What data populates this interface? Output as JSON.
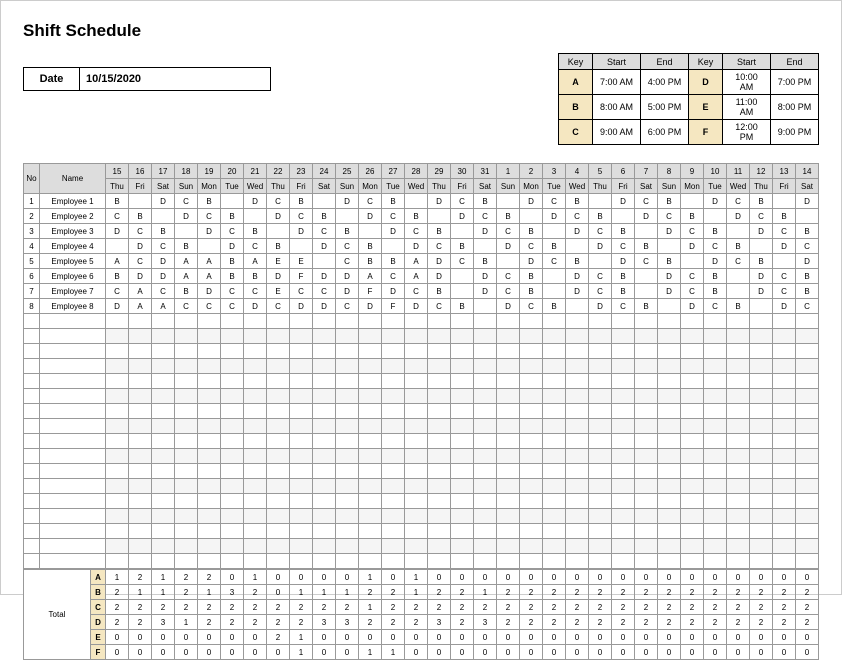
{
  "title": "Shift Schedule",
  "date": {
    "label": "Date",
    "value": "10/15/2020"
  },
  "key_table": {
    "headers": [
      "Key",
      "Start",
      "End",
      "Key",
      "Start",
      "End"
    ],
    "rows": [
      [
        "A",
        "7:00 AM",
        "4:00 PM",
        "D",
        "10:00 AM",
        "7:00 PM"
      ],
      [
        "B",
        "8:00 AM",
        "5:00 PM",
        "E",
        "11:00 AM",
        "8:00 PM"
      ],
      [
        "C",
        "9:00 AM",
        "6:00 PM",
        "F",
        "12:00 PM",
        "9:00 PM"
      ]
    ]
  },
  "schedule": {
    "no_header": "No",
    "name_header": "Name",
    "day_numbers": [
      "15",
      "16",
      "17",
      "18",
      "19",
      "20",
      "21",
      "22",
      "23",
      "24",
      "25",
      "26",
      "27",
      "28",
      "29",
      "30",
      "31",
      "1",
      "2",
      "3",
      "4",
      "5",
      "6",
      "7",
      "8",
      "9",
      "10",
      "11",
      "12",
      "13",
      "14"
    ],
    "day_names": [
      "Thu",
      "Fri",
      "Sat",
      "Sun",
      "Mon",
      "Tue",
      "Wed",
      "Thu",
      "Fri",
      "Sat",
      "Sun",
      "Mon",
      "Tue",
      "Wed",
      "Thu",
      "Fri",
      "Sat",
      "Sun",
      "Mon",
      "Tue",
      "Wed",
      "Thu",
      "Fri",
      "Sat",
      "Sun",
      "Mon",
      "Tue",
      "Wed",
      "Thu",
      "Fri",
      "Sat"
    ],
    "employees": [
      {
        "no": "1",
        "name": "Employee 1",
        "shifts": [
          "B",
          "",
          "D",
          "C",
          "B",
          "",
          "D",
          "C",
          "B",
          "",
          "D",
          "C",
          "B",
          "",
          "D",
          "C",
          "B",
          "",
          "D",
          "C",
          "B",
          "",
          "D",
          "C",
          "B",
          "",
          "D",
          "C",
          "B",
          "",
          "D"
        ]
      },
      {
        "no": "2",
        "name": "Employee 2",
        "shifts": [
          "C",
          "B",
          "",
          "D",
          "C",
          "B",
          "",
          "D",
          "C",
          "B",
          "",
          "D",
          "C",
          "B",
          "",
          "D",
          "C",
          "B",
          "",
          "D",
          "C",
          "B",
          "",
          "D",
          "C",
          "B",
          "",
          "D",
          "C",
          "B",
          ""
        ]
      },
      {
        "no": "3",
        "name": "Employee 3",
        "shifts": [
          "D",
          "C",
          "B",
          "",
          "D",
          "C",
          "B",
          "",
          "D",
          "C",
          "B",
          "",
          "D",
          "C",
          "B",
          "",
          "D",
          "C",
          "B",
          "",
          "D",
          "C",
          "B",
          "",
          "D",
          "C",
          "B",
          "",
          "D",
          "C",
          "B"
        ]
      },
      {
        "no": "4",
        "name": "Employee 4",
        "shifts": [
          "",
          "D",
          "C",
          "B",
          "",
          "D",
          "C",
          "B",
          "",
          "D",
          "C",
          "B",
          "",
          "D",
          "C",
          "B",
          "",
          "D",
          "C",
          "B",
          "",
          "D",
          "C",
          "B",
          "",
          "D",
          "C",
          "B",
          "",
          "D",
          "C"
        ]
      },
      {
        "no": "5",
        "name": "Employee 5",
        "shifts": [
          "A",
          "C",
          "D",
          "A",
          "A",
          "B",
          "A",
          "E",
          "E",
          "",
          "C",
          "B",
          "B",
          "A",
          "D",
          "C",
          "B",
          "",
          "D",
          "C",
          "B",
          "",
          "D",
          "C",
          "B",
          "",
          "D",
          "C",
          "B",
          "",
          "D"
        ]
      },
      {
        "no": "6",
        "name": "Employee 6",
        "shifts": [
          "B",
          "D",
          "D",
          "A",
          "A",
          "B",
          "B",
          "D",
          "F",
          "D",
          "D",
          "A",
          "C",
          "A",
          "D",
          "",
          "D",
          "C",
          "B",
          "",
          "D",
          "C",
          "B",
          "",
          "D",
          "C",
          "B",
          "",
          "D",
          "C",
          "B"
        ]
      },
      {
        "no": "7",
        "name": "Employee 7",
        "shifts": [
          "C",
          "A",
          "C",
          "B",
          "D",
          "C",
          "C",
          "E",
          "C",
          "C",
          "D",
          "F",
          "D",
          "C",
          "B",
          "",
          "D",
          "C",
          "B",
          "",
          "D",
          "C",
          "B",
          "",
          "D",
          "C",
          "B",
          "",
          "D",
          "C",
          "B"
        ]
      },
      {
        "no": "8",
        "name": "Employee 8",
        "shifts": [
          "D",
          "A",
          "A",
          "C",
          "C",
          "C",
          "D",
          "C",
          "D",
          "D",
          "C",
          "D",
          "F",
          "D",
          "C",
          "B",
          "",
          "D",
          "C",
          "B",
          "",
          "D",
          "C",
          "B",
          "",
          "D",
          "C",
          "B",
          "",
          "D",
          "C"
        ]
      }
    ],
    "empty_rows": 17
  },
  "totals": {
    "label": "Total",
    "keys": [
      "A",
      "B",
      "C",
      "D",
      "E",
      "F"
    ],
    "rows": {
      "A": [
        "1",
        "2",
        "1",
        "2",
        "2",
        "0",
        "1",
        "0",
        "0",
        "0",
        "0",
        "1",
        "0",
        "1",
        "0",
        "0",
        "0",
        "0",
        "0",
        "0",
        "0",
        "0",
        "0",
        "0",
        "0",
        "0",
        "0",
        "0",
        "0",
        "0",
        "0"
      ],
      "B": [
        "2",
        "1",
        "1",
        "2",
        "1",
        "3",
        "2",
        "0",
        "1",
        "1",
        "1",
        "2",
        "2",
        "1",
        "2",
        "2",
        "1",
        "2",
        "2",
        "2",
        "2",
        "2",
        "2",
        "2",
        "2",
        "2",
        "2",
        "2",
        "2",
        "2",
        "2"
      ],
      "C": [
        "2",
        "2",
        "2",
        "2",
        "2",
        "2",
        "2",
        "2",
        "2",
        "2",
        "2",
        "1",
        "2",
        "2",
        "2",
        "2",
        "2",
        "2",
        "2",
        "2",
        "2",
        "2",
        "2",
        "2",
        "2",
        "2",
        "2",
        "2",
        "2",
        "2",
        "2"
      ],
      "D": [
        "2",
        "2",
        "3",
        "1",
        "2",
        "2",
        "2",
        "2",
        "2",
        "3",
        "3",
        "2",
        "2",
        "2",
        "3",
        "2",
        "3",
        "2",
        "2",
        "2",
        "2",
        "2",
        "2",
        "2",
        "2",
        "2",
        "2",
        "2",
        "2",
        "2",
        "2"
      ],
      "E": [
        "0",
        "0",
        "0",
        "0",
        "0",
        "0",
        "0",
        "2",
        "1",
        "0",
        "0",
        "0",
        "0",
        "0",
        "0",
        "0",
        "0",
        "0",
        "0",
        "0",
        "0",
        "0",
        "0",
        "0",
        "0",
        "0",
        "0",
        "0",
        "0",
        "0",
        "0"
      ],
      "F": [
        "0",
        "0",
        "0",
        "0",
        "0",
        "0",
        "0",
        "0",
        "1",
        "0",
        "0",
        "1",
        "1",
        "0",
        "0",
        "0",
        "0",
        "0",
        "0",
        "0",
        "0",
        "0",
        "0",
        "0",
        "0",
        "0",
        "0",
        "0",
        "0",
        "0",
        "0"
      ]
    }
  }
}
